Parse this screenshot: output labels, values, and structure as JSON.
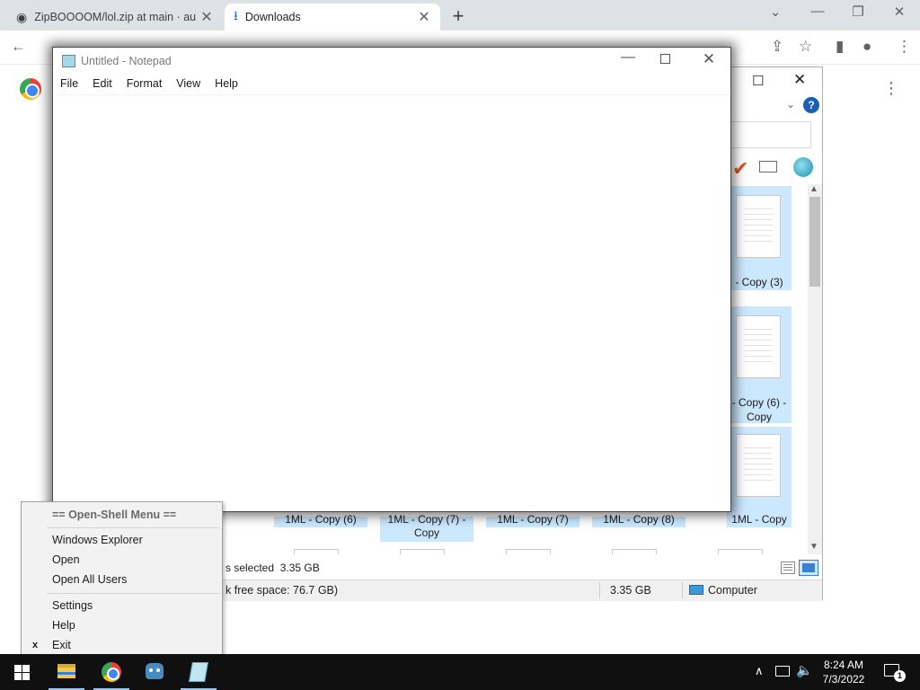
{
  "chrome": {
    "tabs": [
      {
        "title": "ZipBOOOOM/lol.zip at main · au",
        "close": "✕",
        "icon": "github-icon"
      },
      {
        "title": "Downloads",
        "close": "✕",
        "icon": "download-icon"
      }
    ],
    "new_tab": "+",
    "window_controls": {
      "tab_search": "⌄",
      "minimize": "—",
      "restore": "❐",
      "close": "✕"
    },
    "toolbar": {
      "back": "←",
      "share": "⇪",
      "bookmark": "☆",
      "side_panel": "▮",
      "profile": "●",
      "menu": "⋮"
    },
    "page_menu": "⋮"
  },
  "explorer": {
    "maximize": "☐",
    "close": "✕",
    "ribbon_chevron": "⌄",
    "help": "?",
    "items": [
      {
        "label": "- Copy (3)"
      },
      {
        "label": "- Copy (6) -",
        "label2": "Copy"
      },
      {
        "label": "1ML - Copy (6)"
      },
      {
        "label": "1ML - Copy (7) -",
        "label2": "Copy"
      },
      {
        "label": "1ML - Copy (7)"
      },
      {
        "label": "1ML - Copy (8)"
      },
      {
        "label": "1ML - Copy"
      }
    ],
    "scroll_up": "▲",
    "scroll_down": "▼",
    "status_selected": "s selected  3.35 GB",
    "status_free": "k free space: 76.7 GB)",
    "status_size": "3.35 GB",
    "status_location": "Computer"
  },
  "notepad": {
    "title": "Untitled - Notepad",
    "minimize": "—",
    "close": "✕",
    "menu": [
      "File",
      "Edit",
      "Format",
      "View",
      "Help"
    ],
    "content": ""
  },
  "context_menu": {
    "header": "== Open-Shell Menu ==",
    "items": [
      "Windows Explorer",
      "Open",
      "Open All Users",
      "Settings",
      "Help",
      "Exit"
    ],
    "exit_mark": "x"
  },
  "taskbar": {
    "apps": [
      "File Explorer",
      "Google Chrome",
      "Godot",
      "Notepad"
    ],
    "tray_chevron": "∧",
    "volume": "🔈",
    "time": "8:24 AM",
    "date": "7/3/2022",
    "notification_count": "1"
  }
}
